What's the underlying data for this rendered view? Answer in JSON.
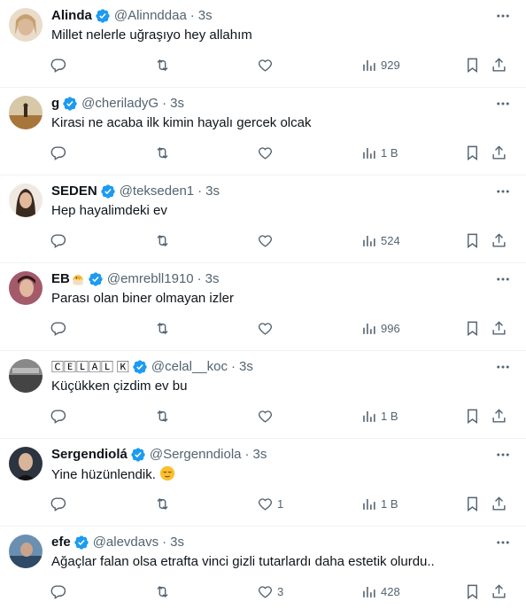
{
  "tweets": [
    {
      "name": "Alinda",
      "handle": "@Alinnddaa",
      "time": "3s",
      "text": "Millet nelerle uğraşıyo hey allahım",
      "likes": "",
      "views": "929"
    },
    {
      "name": "g",
      "handle": "@cheriladyG",
      "time": "3s",
      "text": "Kirasi ne acaba ilk kimin hayalı gercek olcak",
      "likes": "",
      "views": "1 B"
    },
    {
      "name": "SEDEN",
      "handle": "@tekseden1",
      "time": "3s",
      "text": "Hep hayalimdeki ev",
      "likes": "",
      "views": "524"
    },
    {
      "name": "EB",
      "handle": "@emrebll1910",
      "time": "3s",
      "text": "Parası olan biner olmayan izler",
      "likes": "",
      "views": "996"
    },
    {
      "name": "🄲🄴🄻🄰🄻 🄺",
      "handle": "@celal__koc",
      "time": "3s",
      "text": "Küçükken çizdim ev bu",
      "likes": "",
      "views": "1 B"
    },
    {
      "name": "Sergendiolá",
      "handle": "@Sergenndiola",
      "time": "3s",
      "text": "Yine hüzünlendik.",
      "likes": "1",
      "views": "1 B"
    },
    {
      "name": "efe",
      "handle": "@alevdavs",
      "time": "3s",
      "text": "Ağaçlar falan olsa etrafta vinci gizli tutarlardı daha estetik olurdu..",
      "likes": "3",
      "views": "428"
    }
  ],
  "colors": {
    "verified": "#1d9bf0",
    "secondary": "#536471",
    "text": "#0f1419",
    "divider": "#eff3f4"
  }
}
